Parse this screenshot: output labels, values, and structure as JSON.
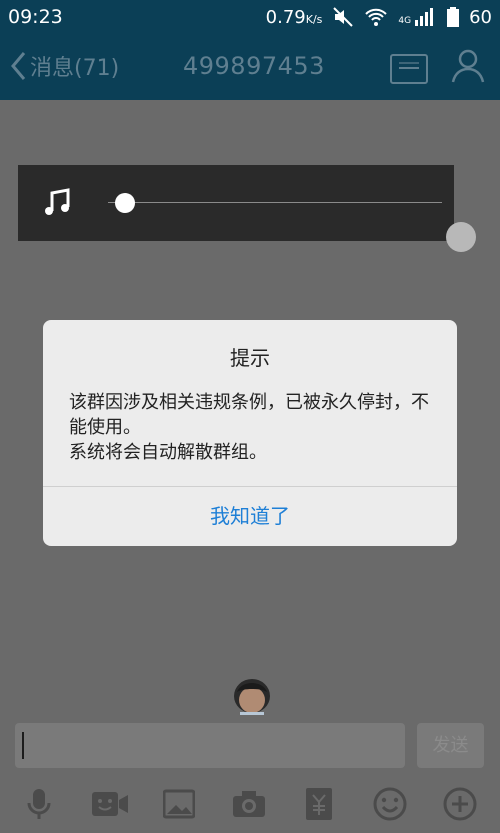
{
  "status": {
    "time": "09:23",
    "speed": "0.79",
    "speed_unit": "K/s",
    "network": "4G",
    "battery": "60"
  },
  "header": {
    "back_label": "消息(71)",
    "title": "499897453"
  },
  "dialog": {
    "title": "提示",
    "message_line1": "该群因涉及相关违规条例，已被永久停封，不能使用。",
    "message_line2": "系统将会自动解散群组。",
    "button": "我知道了"
  },
  "input": {
    "value": "",
    "send_label": "发送"
  },
  "audio": {
    "progress": 0.05
  },
  "icons": [
    "microphone-icon",
    "video-icon",
    "image-icon",
    "camera-icon",
    "red-packet-icon",
    "emoji-icon",
    "add-icon"
  ],
  "colors": {
    "header_bg": "#0b3f56",
    "header_text": "#5f7f90",
    "dialog_button": "#1e7fd6"
  }
}
